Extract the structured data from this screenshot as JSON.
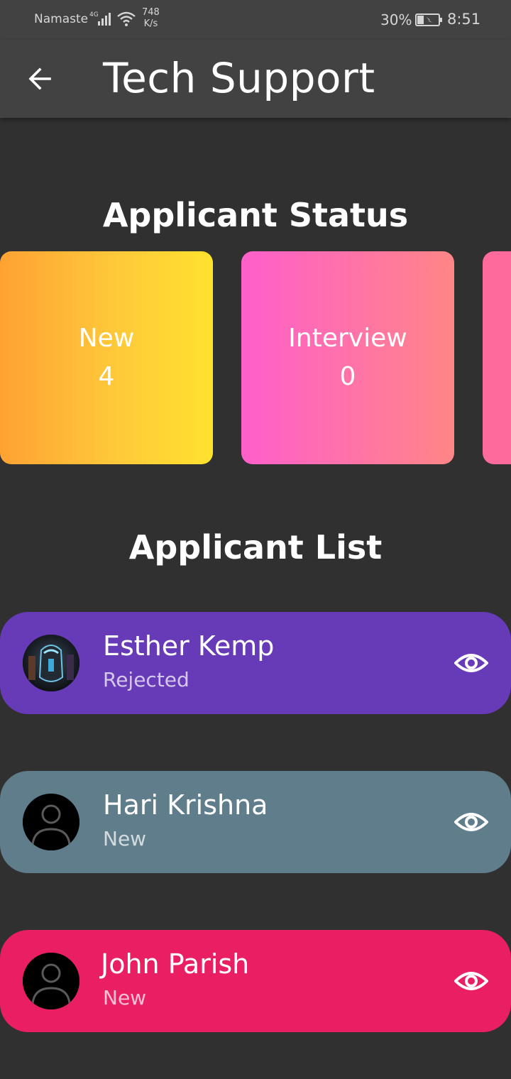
{
  "status_bar": {
    "carrier": "Namaste",
    "network": "4G",
    "speed_value": "748",
    "speed_unit": "K/s",
    "battery_percent": "30%",
    "time": "8:51"
  },
  "app_bar": {
    "title": "Tech Support",
    "back_icon": "arrow-left-icon"
  },
  "status_section": {
    "title": "Applicant Status",
    "cards": [
      {
        "label": "New",
        "count": "4",
        "gradient_start": "#ffa233",
        "gradient_end": "#ffe22e"
      },
      {
        "label": "Interview",
        "count": "0",
        "gradient_start": "#ff5fca",
        "gradient_end": "#ff8686"
      },
      {
        "label": "",
        "count": "",
        "gradient_start": "#ff6a9c",
        "gradient_end": "#ff6a9c"
      }
    ]
  },
  "list_section": {
    "title": "Applicant List",
    "applicants": [
      {
        "name": "Esther Kemp",
        "status": "Rejected",
        "color": "#673ab7",
        "avatar": "photo-avatar",
        "action_icon": "eye-icon"
      },
      {
        "name": "Hari Krishna",
        "status": "New",
        "color": "#607d8b",
        "avatar": "person-placeholder-icon",
        "action_icon": "eye-icon"
      },
      {
        "name": "John Parish",
        "status": "New",
        "color": "#e91e63",
        "avatar": "person-placeholder-icon",
        "action_icon": "eye-icon"
      }
    ]
  },
  "colors": {
    "background": "#303030",
    "app_bar": "#424242",
    "text": "#ffffff"
  }
}
